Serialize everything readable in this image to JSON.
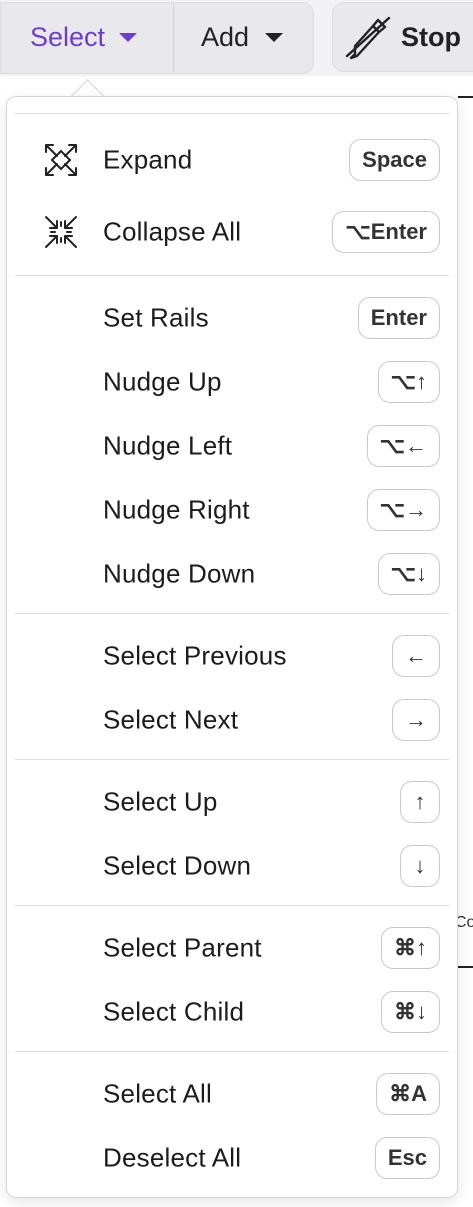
{
  "toolbar": {
    "select_label": "Select",
    "add_label": "Add",
    "stop_label": "Stop"
  },
  "background": {
    "partial_text": "Co"
  },
  "menu": {
    "items": [
      {
        "label": "Expand",
        "shortcut": "Space",
        "icon": "expand-icon"
      },
      {
        "label": "Collapse All",
        "shortcut": "⌥Enter",
        "icon": "collapse-all-icon"
      },
      {
        "label": "Set Rails",
        "shortcut": "Enter"
      },
      {
        "label": "Nudge Up",
        "shortcut": "⌥↑"
      },
      {
        "label": "Nudge Left",
        "shortcut": "⌥←"
      },
      {
        "label": "Nudge Right",
        "shortcut": "⌥→"
      },
      {
        "label": "Nudge Down",
        "shortcut": "⌥↓"
      },
      {
        "label": "Select Previous",
        "shortcut": "←"
      },
      {
        "label": "Select Next",
        "shortcut": "→"
      },
      {
        "label": "Select Up",
        "shortcut": "↑"
      },
      {
        "label": "Select Down",
        "shortcut": "↓"
      },
      {
        "label": "Select Parent",
        "shortcut": "⌘↑"
      },
      {
        "label": "Select Child",
        "shortcut": "⌘↓"
      },
      {
        "label": "Select All",
        "shortcut": "⌘A"
      },
      {
        "label": "Deselect All",
        "shortcut": "Esc"
      }
    ]
  },
  "colors": {
    "accent": "#6f3bd1",
    "toolbar_bg": "#e9e9ed",
    "border": "#d6d6da"
  }
}
